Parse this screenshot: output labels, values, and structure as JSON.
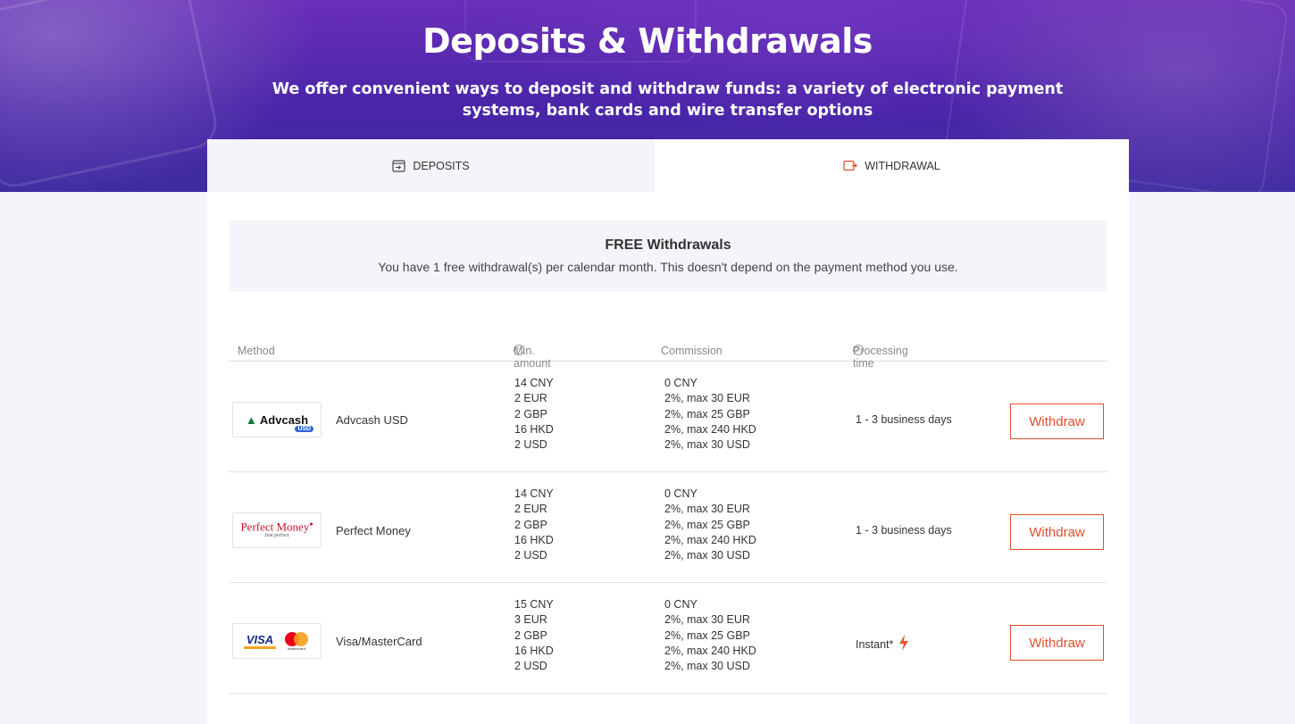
{
  "hero": {
    "title": "Deposits & Withdrawals",
    "subtitle": "We offer convenient ways to deposit and withdraw funds: a variety of electronic payment systems, bank cards and wire transfer options"
  },
  "tabs": [
    {
      "label": "DEPOSITS",
      "icon": "deposit-icon",
      "active": false
    },
    {
      "label": "WITHDRAWAL",
      "icon": "withdrawal-icon",
      "active": true
    }
  ],
  "banner": {
    "title": "FREE Withdrawals",
    "text": "You have 1 free withdrawal(s) per calendar month. This doesn't depend on the payment method you use."
  },
  "table": {
    "headers": {
      "method": "Method",
      "min_amount": "Min. amount",
      "commission": "Commission",
      "processing_time": "Processing time"
    },
    "rows": [
      {
        "logo_text": "Advcash",
        "logo_badge": "USD",
        "name": "Advcash USD",
        "min_amounts": [
          "14 CNY",
          "2 EUR",
          "2 GBP",
          "16 HKD",
          "2 USD"
        ],
        "commissions": [
          "0 CNY",
          "2%, max 30 EUR",
          "2%, max 25 GBP",
          "2%, max 240 HKD",
          "2%, max 30 USD"
        ],
        "processing_time": "1 - 3 business days",
        "button": "Withdraw"
      },
      {
        "logo_text": "Perfect Money",
        "logo_sub": "Just perfect",
        "name": "Perfect Money",
        "min_amounts": [
          "14 CNY",
          "2 EUR",
          "2 GBP",
          "16 HKD",
          "2 USD"
        ],
        "commissions": [
          "0 CNY",
          "2%, max 30 EUR",
          "2%, max 25 GBP",
          "2%, max 240 HKD",
          "2%, max 30 USD"
        ],
        "processing_time": "1 - 3 business days",
        "button": "Withdraw"
      },
      {
        "logo_text": "VISA",
        "logo_sub": "mastercard",
        "name": "Visa/MasterCard",
        "min_amounts": [
          "15 CNY",
          "3 EUR",
          "2 GBP",
          "16 HKD",
          "2 USD"
        ],
        "commissions": [
          "0 CNY",
          "2%, max 30 EUR",
          "2%, max 25 GBP",
          "2%, max 240 HKD",
          "2%, max 30 USD"
        ],
        "processing_time": "Instant*",
        "processing_icon": "lightning-icon",
        "button": "Withdraw"
      }
    ]
  },
  "colors": {
    "accent": "#e2502c",
    "hero_purple": "#5a2ab0",
    "page_bg": "#f4f5fa"
  }
}
